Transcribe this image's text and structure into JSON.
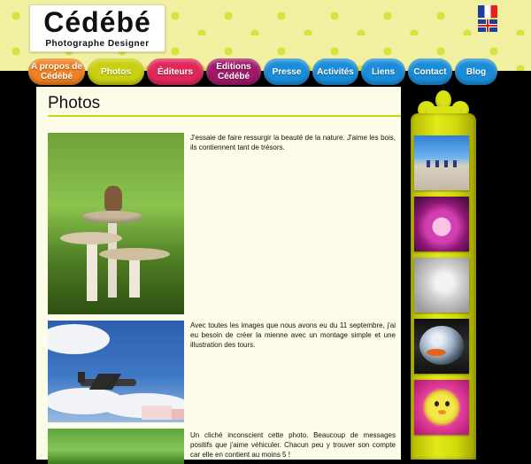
{
  "site": {
    "logo_title": "Cédébé",
    "logo_subtitle": "Photographe Designer"
  },
  "nav": [
    {
      "label": "A propos de Cédébé",
      "color": "#f08020"
    },
    {
      "label": "Photos",
      "color": "#c9d010"
    },
    {
      "label": "Éditeurs",
      "color": "#e0285a"
    },
    {
      "label": "Editions Cédébé",
      "color": "#a0186a"
    },
    {
      "label": "Presse",
      "color": "#1a8cd8"
    },
    {
      "label": "Activités",
      "color": "#1a8cd8"
    },
    {
      "label": "Liens",
      "color": "#1a8cd8"
    },
    {
      "label": "Contact",
      "color": "#1a8cd8"
    },
    {
      "label": "Blog",
      "color": "#1a8cd8"
    }
  ],
  "page": {
    "title": "Photos"
  },
  "photos": [
    {
      "caption": "J'essaie de faire ressurgir la beauté de la nature. J'aime les bois, ils contiennent tant de trésors."
    },
    {
      "caption": "Avec toutes les images que nous avons eu du 11 septembre, j'ai eu besoin de créer la mienne avec un montage simple et une illustration des tours."
    },
    {
      "caption": "Un cliché inconscient cette photo. Beaucoup de messages positifs que j'aime véhiculer. Chacun peu y trouver son compte car elle en contient au moins 5 !"
    }
  ],
  "flags": [
    "french-flag-icon",
    "uk-flag-icon"
  ],
  "thumbnails": [
    "desert-thumbnail",
    "pink-rabbit-thumbnail",
    "hand-print-thumbnail",
    "fish-bowl-thumbnail",
    "duck-thumbnail"
  ],
  "colors": {
    "accent": "#c9d417",
    "rail": "#dbe214",
    "content_bg": "#fcfce8"
  }
}
